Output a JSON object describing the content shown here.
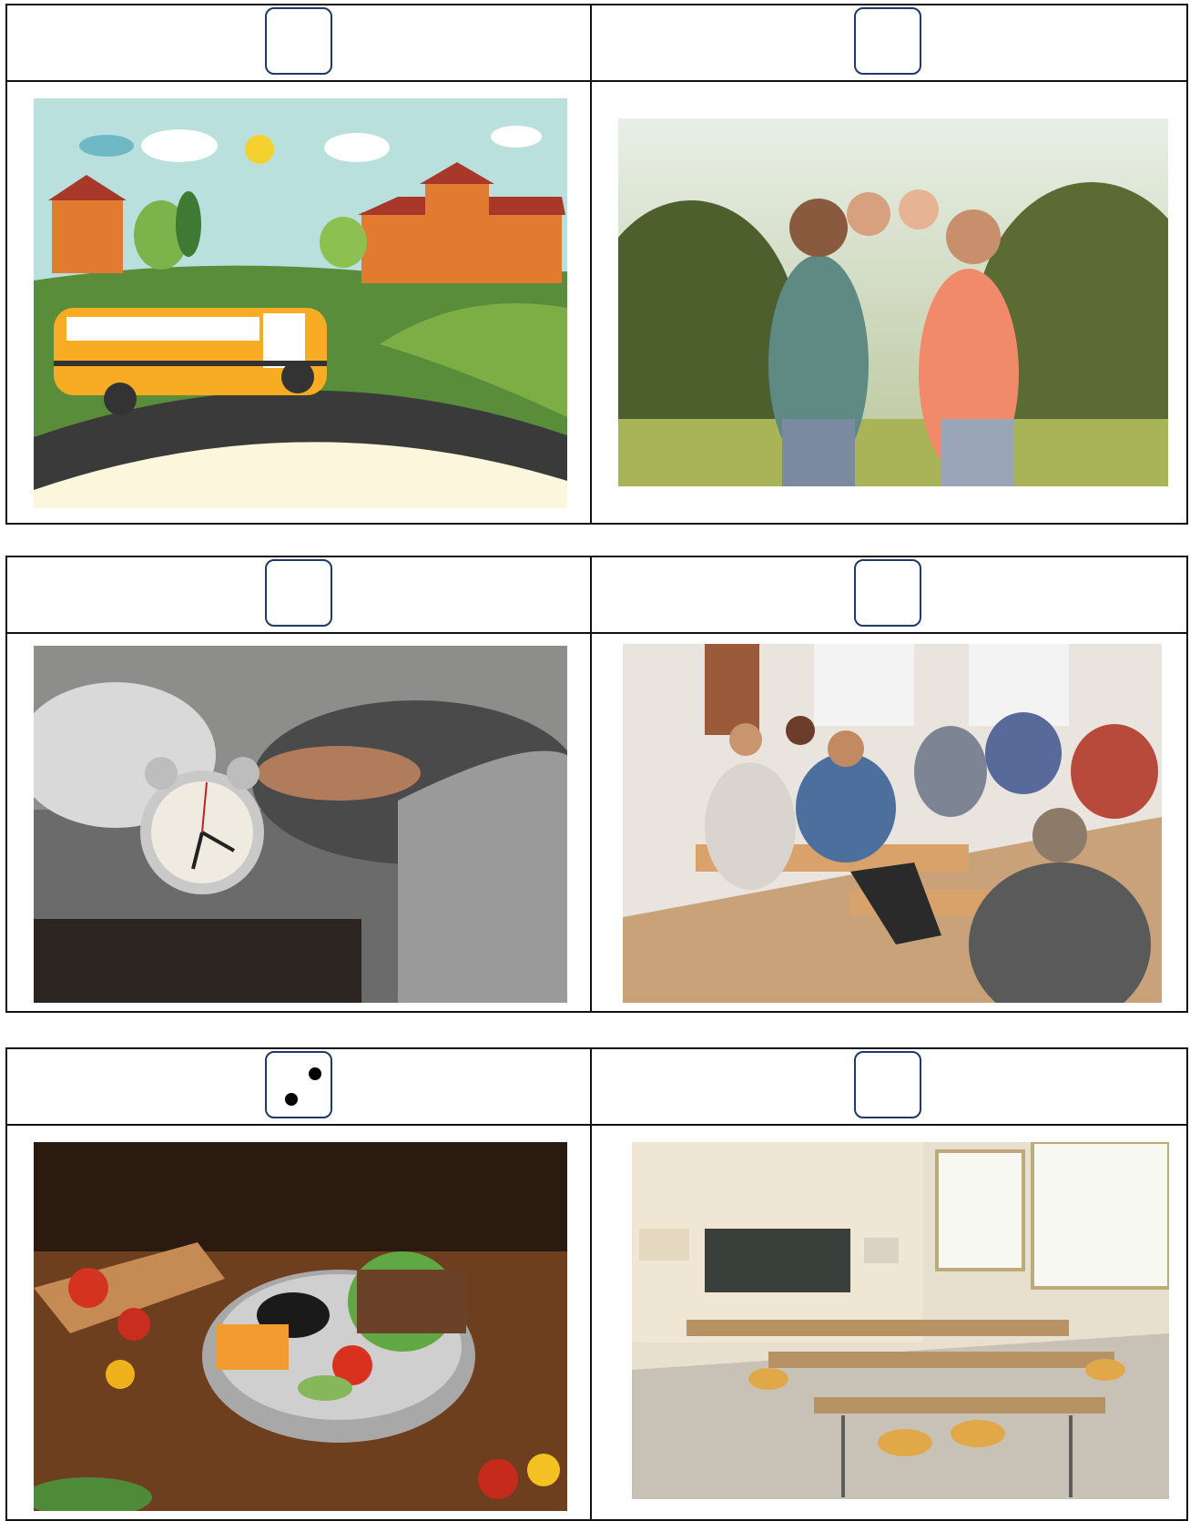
{
  "rows": [
    {
      "cells": [
        {
          "dice_value": 0,
          "image": "school-bus-illustration"
        },
        {
          "dice_value": 0,
          "image": "family-piggyback-photo"
        }
      ]
    },
    {
      "cells": [
        {
          "dice_value": 0,
          "image": "alarm-clock-photo"
        },
        {
          "dice_value": 0,
          "image": "students-in-classroom-photo"
        }
      ]
    },
    {
      "cells": [
        {
          "dice_value": 2,
          "image": "lunchbox-photo"
        },
        {
          "dice_value": 0,
          "image": "empty-classroom-photo"
        }
      ]
    }
  ],
  "colors": {
    "dice_border": "#1e3a66",
    "grid_border": "#111111"
  }
}
